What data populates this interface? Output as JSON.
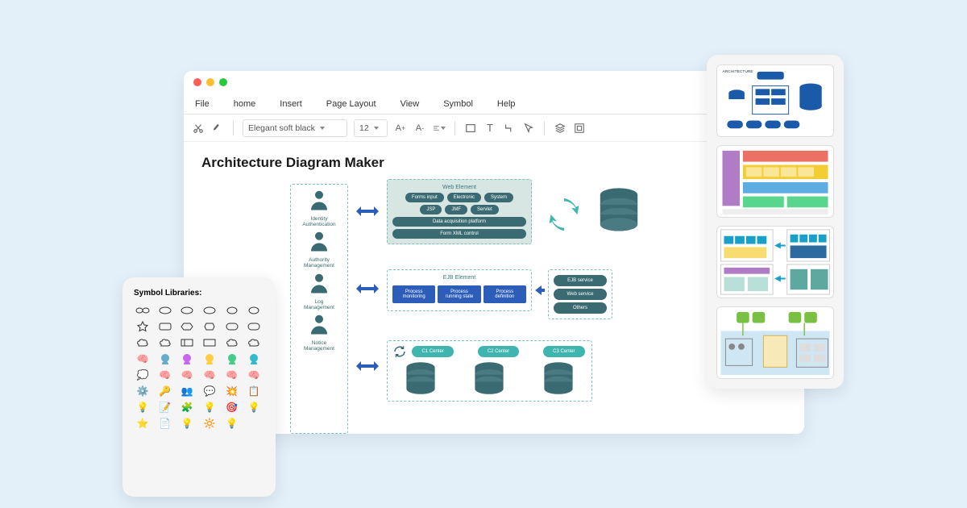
{
  "menubar": [
    "File",
    "home",
    "Insert",
    "Page Layout",
    "View",
    "Symbol",
    "Help"
  ],
  "toolbar": {
    "font": "Elegant soft black",
    "size": "12"
  },
  "canvas": {
    "title": "Architecture Diagram Maker"
  },
  "roles": [
    {
      "name": "Identity",
      "sub": "Authentication"
    },
    {
      "name": "Authority",
      "sub": "Management"
    },
    {
      "name": "Log",
      "sub": "Management"
    },
    {
      "name": "Notice",
      "sub": "Management"
    }
  ],
  "web": {
    "title": "Web Element",
    "row1": [
      "Forms input",
      "Electronic",
      "System"
    ],
    "row2": [
      "JSP",
      "JMF",
      "Servlet"
    ],
    "bar1": "Data acquisition platform",
    "bar2": "Form XML control"
  },
  "ejb": {
    "title": "EJB Element",
    "boxes": [
      "Process monitoring",
      "Process running state",
      "Process definition"
    ]
  },
  "svc": [
    "EJB service",
    "Web service",
    "Others"
  ],
  "centers": [
    "C1 Center",
    "C2 Center",
    "C3 Center"
  ],
  "symlib": {
    "title": "Symbol Libraries:"
  }
}
